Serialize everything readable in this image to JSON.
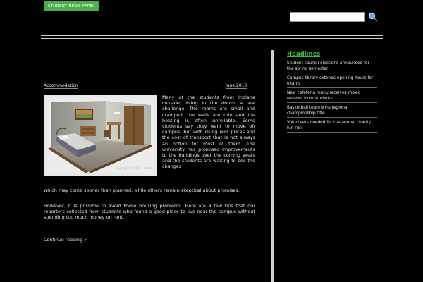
{
  "header": {
    "brand_label": "STUDENT NEWS PAPER",
    "search_placeholder": ""
  },
  "article": {
    "category": "Accommodation",
    "date": "June 2013",
    "paragraph_1_part_a": "Many of the students from Indiana consider living in the dorms a real challenge. The rooms are small and cramped, the walls are thin and the heating is often unreliable. Some students say they want to move off campus, but with rising rent prices and the cost of transport that is not always an option for most of them. The university has promised improvements to the buildings over the coming years and the students are waiting to see the changes",
    "paragraph_1_part_b": "which may come sooner than planned, while others remain skeptical about promises.",
    "paragraph_2": "However, it is possible to avoid these housing problems. Here are a few tips that our reporters collected from students who found a good place to live near the campus without spending too much money on rent.",
    "read_more": "Continue reading »",
    "image_caption": "Copyright © 2013 - Dorm"
  },
  "sidebar": {
    "title": "Headlines",
    "items": [
      "Student council elections announced for the spring semester",
      "Campus library extends opening hours for exams",
      "New cafeteria menu receives mixed reviews from students",
      "Basketball team wins regional championship title",
      "Volunteers needed for the annual charity fun run"
    ]
  },
  "colors": {
    "background": "#000000",
    "accent": "#3fb43f",
    "text": "#e2e2e2"
  }
}
